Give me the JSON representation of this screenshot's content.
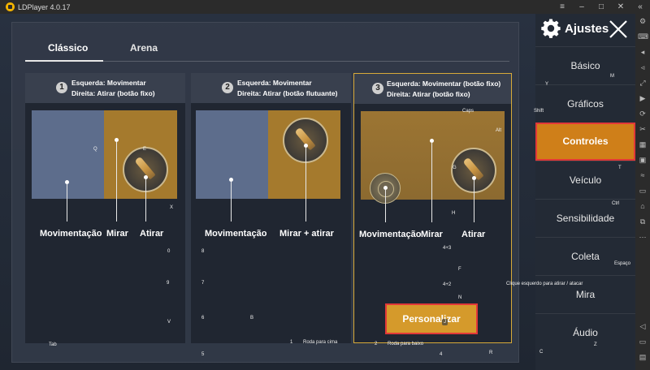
{
  "window": {
    "title": "LDPlayer 4.0.17"
  },
  "tabs": [
    {
      "label": "Clássico"
    },
    {
      "label": "Arena"
    }
  ],
  "cards": [
    {
      "number": "1",
      "line1": "Esquerda: Movimentar",
      "line2": "Direita: Atirar (botão fixo)",
      "labels": [
        "Movimentação",
        "Mirar",
        "Atirar"
      ]
    },
    {
      "number": "2",
      "line1": "Esquerda: Movimentar",
      "line2": "Direita: Atirar (botão flutuante)",
      "labels": [
        "Movimentação",
        "Mirar + atirar"
      ]
    },
    {
      "number": "3",
      "line1": "Esquerda: Movimentar (botão fixo)",
      "line2": "Direita: Atirar (botão fixo)",
      "labels": [
        "Movimentação",
        "Mirar",
        "Atirar"
      ]
    }
  ],
  "customize_button": {
    "label": "Personalizar"
  },
  "menu": {
    "title": "Ajustes",
    "items": [
      {
        "label": "Básico"
      },
      {
        "label": "Gráficos"
      },
      {
        "label": "Controles",
        "active": true
      },
      {
        "label": "Veículo"
      },
      {
        "label": "Sensibilidade"
      },
      {
        "label": "Coleta"
      },
      {
        "label": "Mira"
      },
      {
        "label": "Áudio"
      }
    ]
  },
  "keymap_labels": [
    "Caps",
    "Alt",
    "Q",
    "E",
    "X",
    "G",
    "H",
    "4+3",
    "F",
    "4+2",
    "N",
    "0",
    "9",
    "V",
    "8",
    "7",
    "6",
    "B",
    "5",
    "Tab",
    "1",
    "Roda para cima",
    "2",
    "Roda para baixo",
    "4",
    "R",
    "Shift",
    "M",
    "Y",
    "T",
    "Ctrl",
    "Espaço",
    "Clique esquerdo para atirar / atacar",
    "C",
    "Z",
    "J"
  ],
  "colors": {
    "accent_orange": "#cf7f19",
    "highlight_red": "#e23838",
    "selected_border": "#d8aa39"
  }
}
